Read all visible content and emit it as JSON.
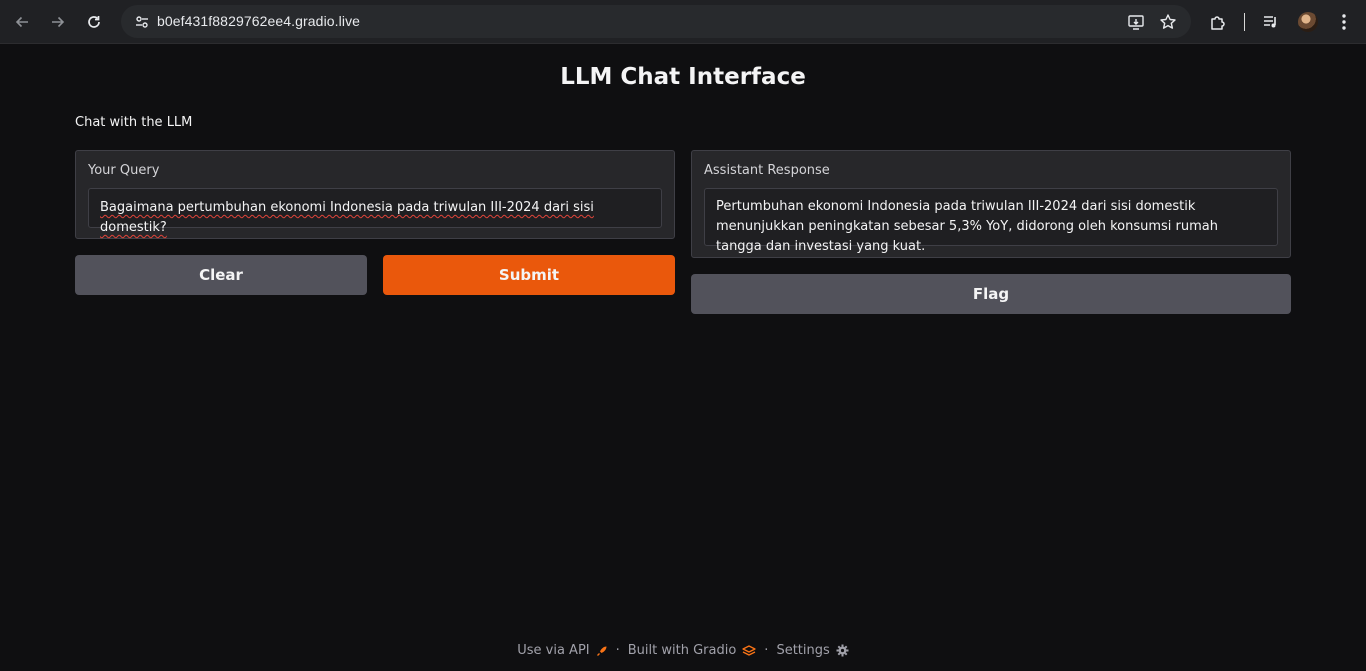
{
  "browser": {
    "url": "b0ef431f8829762ee4.gradio.live",
    "icons": [
      "back-arrow-icon",
      "forward-arrow-icon",
      "reload-icon",
      "site-info-icon",
      "install-app-icon",
      "bookmark-star-icon",
      "extensions-puzzle-icon",
      "media-controls-icon",
      "profile-avatar",
      "kebab-menu-icon"
    ]
  },
  "app": {
    "title": "LLM Chat Interface",
    "description": "Chat with the LLM",
    "query": {
      "label": "Your Query",
      "value": "Bagaimana pertumbuhan ekonomi Indonesia pada triwulan III-2024 dari sisi domestik?"
    },
    "response": {
      "label": "Assistant Response",
      "value": "Pertumbuhan ekonomi Indonesia pada triwulan III-2024 dari sisi domestik menunjukkan peningkatan sebesar 5,3% YoY, didorong oleh konsumsi rumah tangga dan investasi yang kuat."
    },
    "buttons": {
      "clear": "Clear",
      "submit": "Submit",
      "flag": "Flag"
    },
    "colors": {
      "background": "#0f0f11",
      "panel": "#27272a",
      "primary": "#ea580c",
      "secondary": "#52525b"
    }
  },
  "footer": {
    "api": "Use via API",
    "built": "Built with Gradio",
    "settings": "Settings",
    "separator": "·"
  }
}
